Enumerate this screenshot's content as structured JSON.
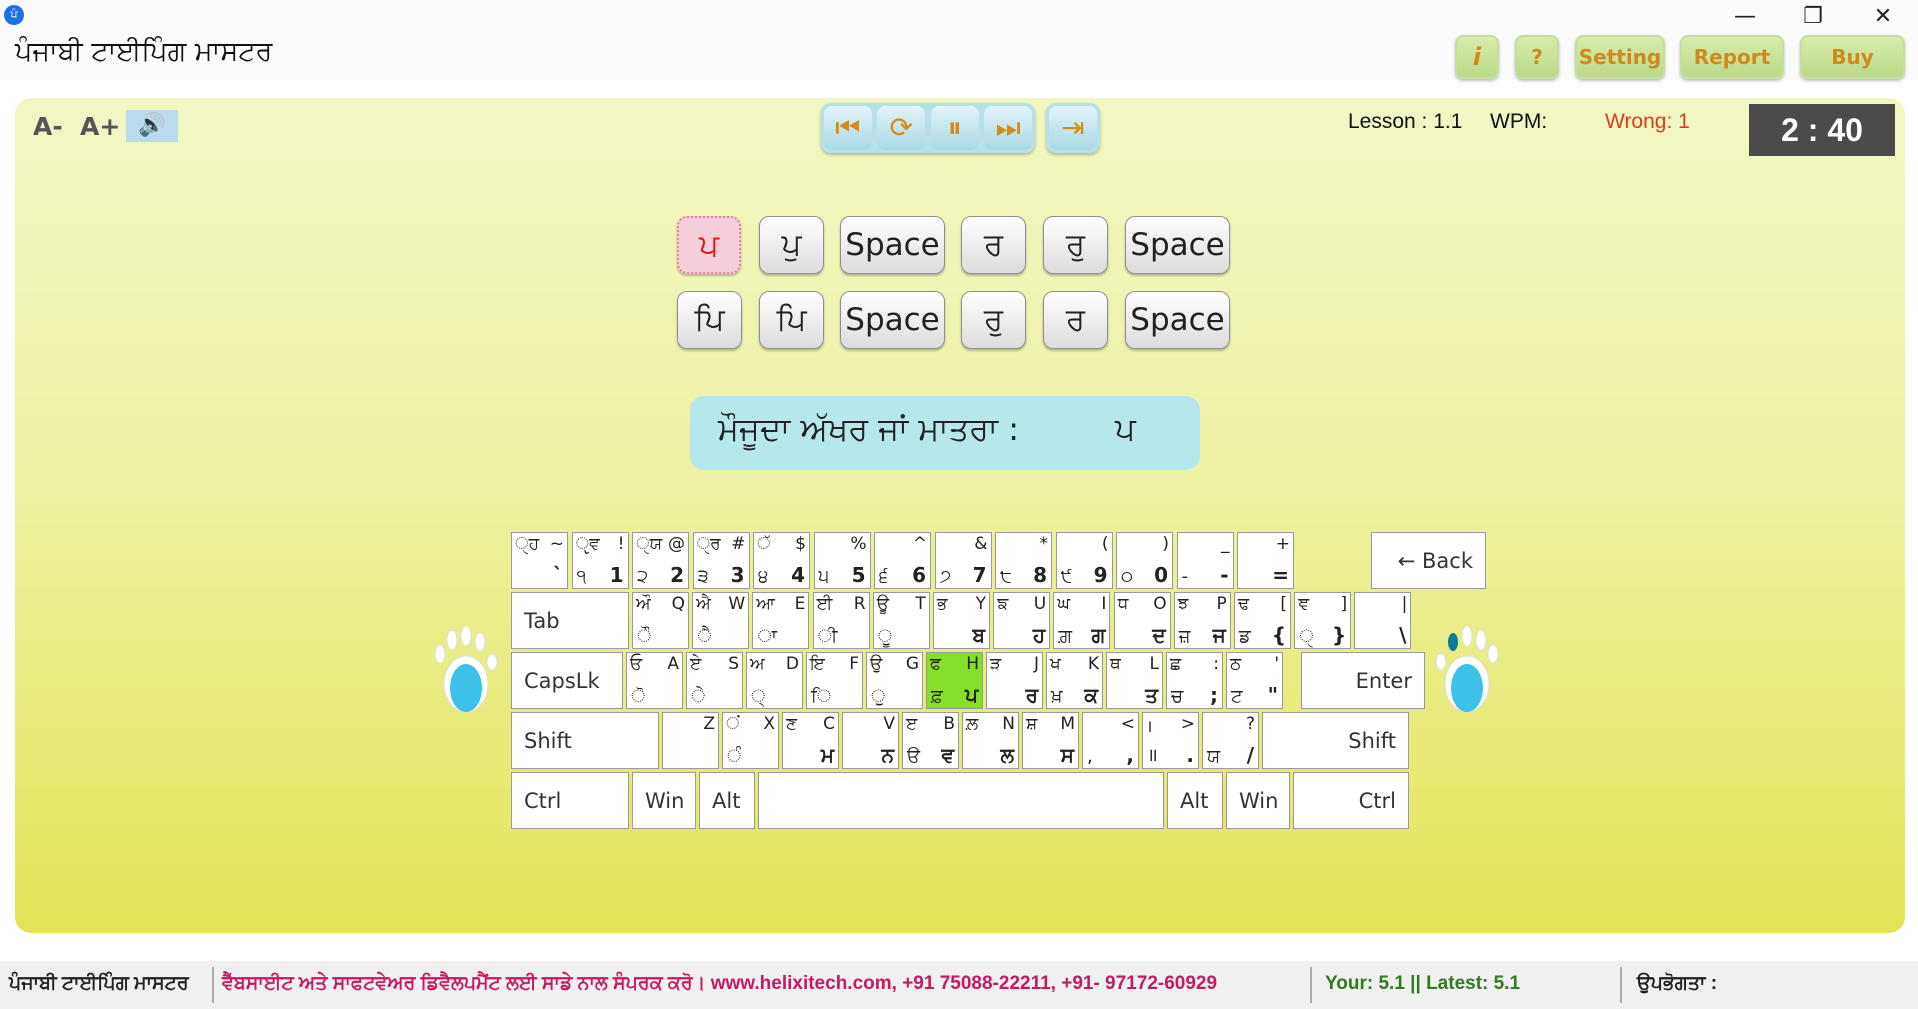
{
  "window": {
    "app_icon": "ਪੰ",
    "title": "ਪੰਜਾਬੀ ਟਾਈਪਿੰਗ ਮਾਸਟਰ",
    "minimize": "—",
    "restore": "❐",
    "close": "✕"
  },
  "toolbar": {
    "info": "i",
    "help": "?",
    "setting": "Setting",
    "report": "Report",
    "buy": "Buy"
  },
  "controls": {
    "font_decrease": "A-",
    "font_increase": "A+",
    "speaker_icon": "🔊",
    "first": "⏮",
    "restart": "⟳",
    "pause": "⏸",
    "next": "⏭",
    "exit": "⇥"
  },
  "stats": {
    "lesson": "Lesson : 1.1",
    "wpm": "WPM:",
    "wrong": "Wrong: 1",
    "timer": "2 : 40"
  },
  "lesson_rows": [
    [
      "ਪ",
      "ਪੁ",
      "Space",
      "ਰ",
      "ਰੁ",
      "Space"
    ],
    [
      "ਪਿ",
      "ਪਿ",
      "Space",
      "ਰੁ",
      "ਰ",
      "Space"
    ]
  ],
  "current": {
    "label": "ਮੌਜੂਦਾ ਅੱਖਰ ਜਾਂ ਮਾਤਰਾ :",
    "char": "ਪ"
  },
  "keyboard": {
    "row1": [
      [
        "ੑਹ",
        "~",
        "",
        "`"
      ],
      [
        "ੵਵ",
        "!",
        "੧",
        "1"
      ],
      [
        "ੑਯ",
        "@",
        "੨",
        "2"
      ],
      [
        "ੑਰ",
        "#",
        "੩",
        "3"
      ],
      [
        "ੱ",
        "$",
        "੪",
        "4"
      ],
      [
        "",
        "%",
        "੫",
        "5"
      ],
      [
        "",
        "^",
        "੬",
        "6"
      ],
      [
        "",
        "&",
        "੭",
        "7"
      ],
      [
        "",
        "*",
        "੮",
        "8"
      ],
      [
        "",
        "(",
        "੯",
        "9"
      ],
      [
        "",
        ")",
        "੦",
        "0"
      ],
      [
        "",
        "_",
        "-",
        "-"
      ],
      [
        "",
        "+",
        "",
        "="
      ]
    ],
    "back": "← Back",
    "tab": "Tab",
    "row2": [
      [
        "ਔ",
        "Q",
        "ੌ",
        ""
      ],
      [
        "ਐ",
        "W",
        "ੈ",
        ""
      ],
      [
        "ਆ",
        "E",
        "ਾ",
        ""
      ],
      [
        "ਈ",
        "R",
        "ੀ",
        ""
      ],
      [
        "ਊ",
        "T",
        "ੂ",
        ""
      ],
      [
        "ਭ",
        "Y",
        "",
        "ਬ"
      ],
      [
        "ਙ",
        "U",
        "",
        "ਹ"
      ],
      [
        "ਘ",
        "I",
        "ਗ਼",
        "ਗ"
      ],
      [
        "ਧ",
        "O",
        "",
        "ਦ"
      ],
      [
        "ਝ",
        "P",
        "ਜ਼",
        "ਜ"
      ],
      [
        "ਢ",
        "[",
        "ਡ",
        "{"
      ],
      [
        "ਞ",
        "]",
        "ੑ",
        "}"
      ],
      [
        "",
        "|",
        "",
        "\\"
      ]
    ],
    "capslock": "CapsLk",
    "row3": [
      [
        "ਓ",
        "A",
        "ੋ",
        ""
      ],
      [
        "ਏ",
        "S",
        "ੇ",
        ""
      ],
      [
        "ਅ",
        "D",
        "੍",
        ""
      ],
      [
        "ਇ",
        "F",
        "ਿ",
        ""
      ],
      [
        "ਉ",
        "G",
        "ੁ",
        ""
      ],
      [
        "ਫ",
        "H",
        "ਫ਼",
        "ਪ"
      ],
      [
        "ੜ",
        "J",
        "",
        "ਰ"
      ],
      [
        "ਖ",
        "K",
        "ਖ਼",
        "ਕ"
      ],
      [
        "ਥ",
        "L",
        "",
        "ਤ"
      ],
      [
        "ਛ",
        ":",
        "ਚ",
        ";"
      ],
      [
        "ਠ",
        "'",
        "ਟ",
        "\""
      ]
    ],
    "enter": "Enter",
    "shift_left": "Shift",
    "row4": [
      [
        "",
        "Z",
        "",
        ""
      ],
      [
        "ਂ",
        "X",
        "ੰ",
        ""
      ],
      [
        "ਣ",
        "C",
        "",
        "ਮ"
      ],
      [
        "",
        "V",
        "",
        "ਨ"
      ],
      [
        "ੲ",
        "B",
        "ੳ",
        "ਵ"
      ],
      [
        "ਲ਼",
        "N",
        "",
        "ਲ"
      ],
      [
        "ਸ਼",
        "M",
        "",
        "ਸ"
      ],
      [
        "",
        "<",
        ",",
        ","
      ],
      [
        "।",
        ">",
        "॥",
        "."
      ],
      [
        "",
        "?",
        "ਯ",
        "/"
      ]
    ],
    "shift_right": "Shift",
    "ctrl_left": "Ctrl",
    "win_left": "Win",
    "alt_left": "Alt",
    "alt_right": "Alt",
    "win_right": "Win",
    "ctrl_right": "Ctrl",
    "highlight_color": "#84df2a"
  },
  "status_bar": {
    "app": "ਪੰਜਾਬੀ ਟਾਈਪਿੰਗ ਮਾਸਟਰ",
    "contact": "ਵੈੱਬਸਾਈਟ ਅਤੇ ਸਾਫਟਵੇਅਰ ਡਿਵੈਲਪਮੈਂਟ ਲਈ ਸਾਡੇ ਨਾਲ ਸੰਪਰਕ ਕਰੋ। www.helixitech.com, +91 75088-22211, +91- 97172-60929",
    "version": "Your: 5.1 || Latest: 5.1",
    "user": "ਉਪਭੋਗਤਾ :"
  }
}
